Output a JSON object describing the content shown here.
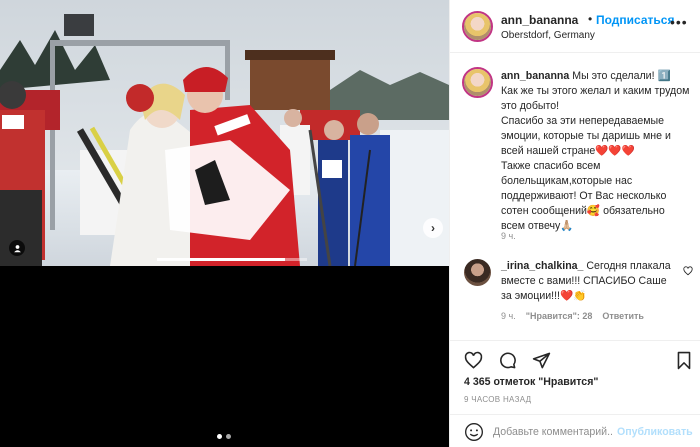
{
  "post": {
    "username": "ann_bananna",
    "follow_label": "Подписаться",
    "separator": "•",
    "location": "Oberstdorf, Germany",
    "more_icon": "more-horizontal-icon"
  },
  "media": {
    "image_description_icon": "photo",
    "progress_fraction": 0.85,
    "slide_count": 2,
    "active_slide": 0
  },
  "caption": {
    "username": "ann_bananna",
    "text_line1": "Мы это сделали! 1️⃣",
    "text_body": "Как же ты этого желал и каким трудом это добыто!\nСпасибо за эти непередаваемые эмоции, которые ты даришь мне и всей нашей стране❤️❤️❤️\nТакже спасибо всем болельщикам,которые нас поддерживают! От Вас несколько сотен сообщений🥰 обязательно всем отвечу🙏🏼",
    "time": "9 ч."
  },
  "comment": {
    "username": "_irina_chalkina_",
    "text": "Сегодня плакала вместе с вами!!! СПАСИБО Саше за эмоции!!!❤️👏",
    "time": "9 ч.",
    "likes": "\"Нравится\": 28",
    "reply": "Ответить"
  },
  "actions": {
    "likes": "4 365 отметок \"Нравится\"",
    "posted": "9 ЧАСОВ НАЗАД"
  },
  "add_comment": {
    "placeholder": "Добавьте комментарий...",
    "publish_label": "Опубликовать"
  },
  "colors": {
    "link": "#0095f6",
    "publish_disabled": "#b2dffc",
    "meta_gray": "#8e8e8e"
  }
}
